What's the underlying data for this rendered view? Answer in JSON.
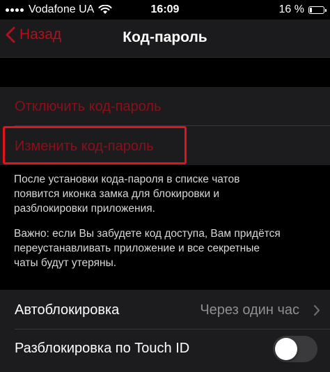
{
  "status_bar": {
    "carrier": "Vodafone UA",
    "time": "16:09",
    "battery_percent": "16 %",
    "battery_level": 0.16
  },
  "nav": {
    "back_label": "Назад",
    "title": "Код-пароль"
  },
  "passcode_section": {
    "disable_label": "Отключить код-пароль",
    "change_label": "Изменить код-пароль",
    "footer_lines_1": [
      "После установки кода-пароля в списке чатов",
      "появится иконка замка для блокировки и",
      "разблокировки приложения."
    ],
    "footer_lines_2": [
      "Важно: если Вы забудете код доступа, Вам придётся",
      "переустанавливать приложение и все секретные",
      "чаты будут утеряны."
    ]
  },
  "settings": {
    "autolock_label": "Автоблокировка",
    "autolock_value": "Через один час",
    "touch_id_label": "Разблокировка по Touch ID",
    "touch_id_enabled": false
  },
  "colors": {
    "accent_red": "#b1101c",
    "highlight_red": "#e3131b",
    "cell_bg": "#1c1c1e"
  }
}
